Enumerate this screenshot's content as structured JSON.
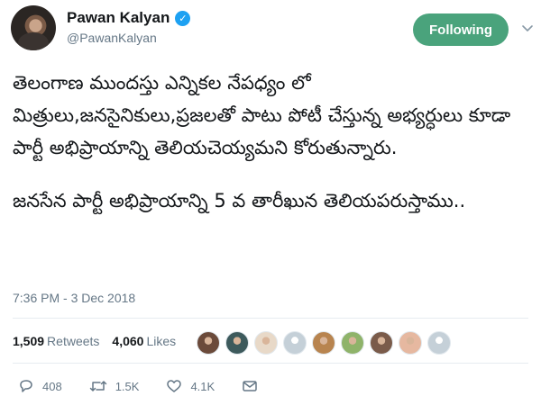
{
  "user": {
    "display_name": "Pawan Kalyan",
    "handle": "@PawanKalyan",
    "verified": true
  },
  "follow_button": {
    "label": "Following"
  },
  "tweet": {
    "paragraph1": "తెలంగాణ ముందస్తు ఎన్నికల నేపధ్యం లో మిత్రులు,జనసైనికులు,ప్రజలతో పాటు పోటీ చేస్తున్న అభ్యర్ధులు కూడా పార్టీ అభిప్రాయాన్ని తెలియచెయ్యమని కోరుతున్నారు.",
    "paragraph2": "జనసేన పార్టీ అభిప్రాయాన్ని 5 వ తారీఖున తెలియపరుస్తాము..",
    "timestamp": "7:36 PM - 3 Dec 2018"
  },
  "stats": {
    "retweets_count": "1,509",
    "retweets_label": "Retweets",
    "likes_count": "4,060",
    "likes_label": "Likes"
  },
  "likers": [
    {
      "icon": "user-avatar",
      "color": "#6b4a3a"
    },
    {
      "icon": "user-avatar",
      "color": "#3d5a5c"
    },
    {
      "icon": "user-avatar",
      "color": "#e8d9c8"
    },
    {
      "icon": "default-avatar",
      "color": "#c5d0d8"
    },
    {
      "icon": "user-avatar",
      "color": "#b8844f"
    },
    {
      "icon": "user-avatar",
      "color": "#8fb36a"
    },
    {
      "icon": "user-avatar",
      "color": "#7a5b4a"
    },
    {
      "icon": "user-avatar",
      "color": "#e6b8a0"
    },
    {
      "icon": "default-avatar",
      "color": "#c5d0d8"
    }
  ],
  "actions": {
    "reply_count": "408",
    "retweet_count": "1.5K",
    "like_count": "4.1K"
  },
  "colors": {
    "follow_button_bg": "#4aa37c",
    "verified_badge": "#1da1f2",
    "secondary_text": "#657786"
  }
}
